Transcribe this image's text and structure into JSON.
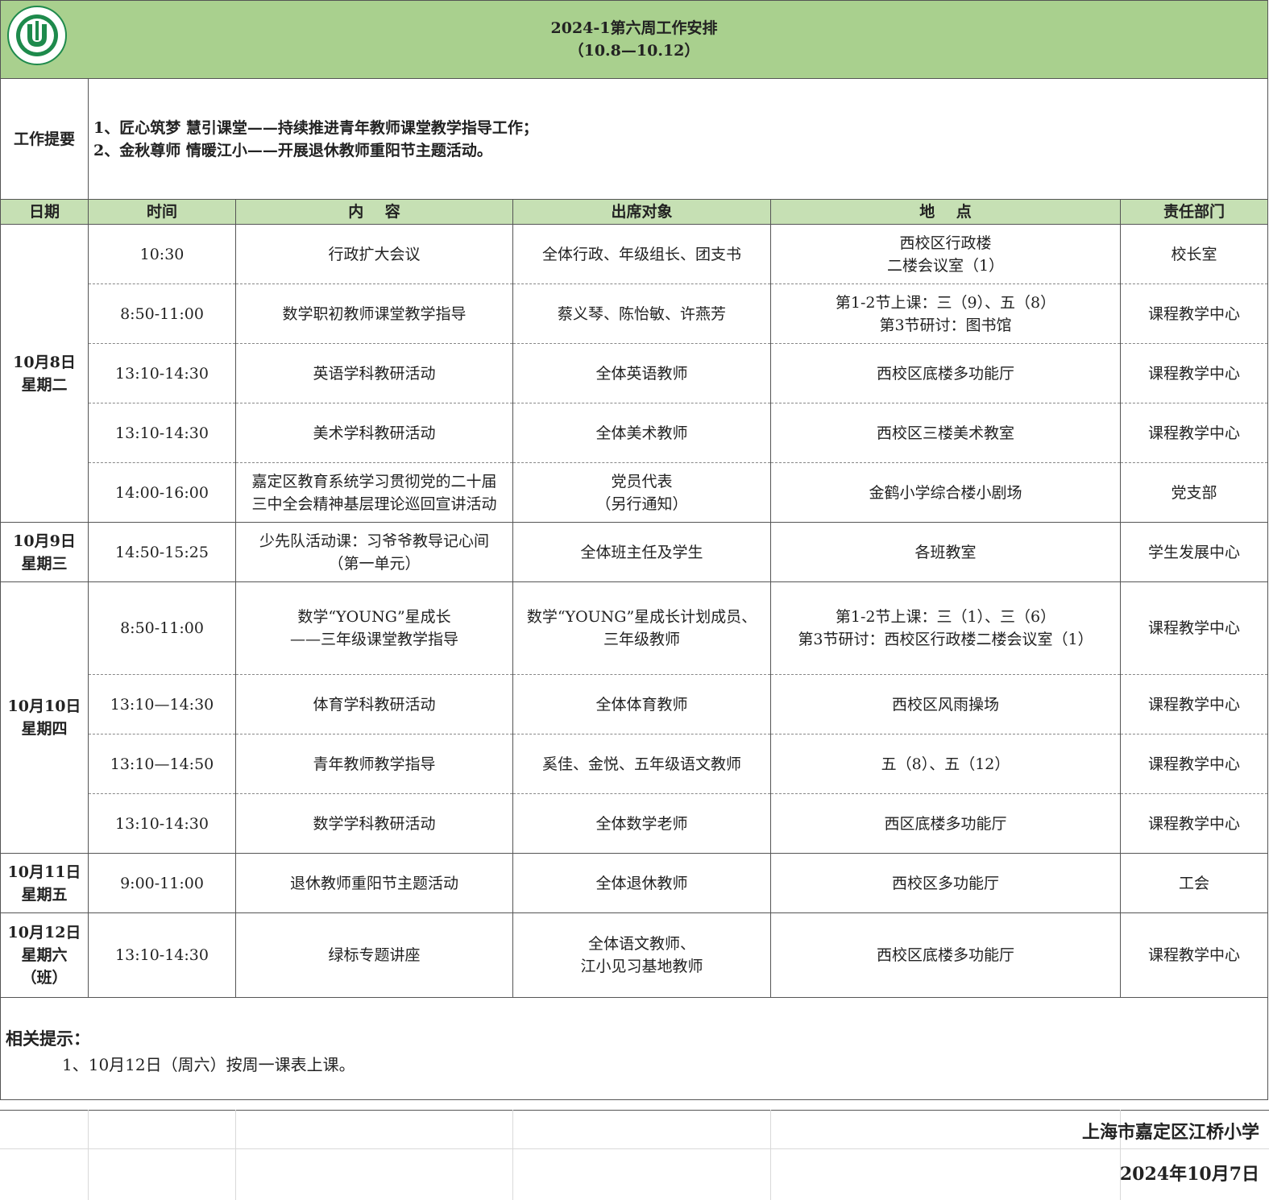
{
  "title": {
    "line1": "2024-1第六周工作安排",
    "line2": "（10.8—10.12）"
  },
  "logo": {
    "icon": "school-logo-icon",
    "color": "#1e8a4c"
  },
  "summary": {
    "label": "工作提要",
    "items": [
      "1、匠心筑梦  慧引课堂——持续推进青年教师课堂教学指导工作；",
      "2、金秋尊师  情暖江小——开展退休教师重阳节主题活动。"
    ]
  },
  "headers": {
    "date": "日期",
    "time": "时间",
    "content": "内    容",
    "attendees": "出席对象",
    "location": "地    点",
    "department": "责任部门"
  },
  "days": [
    {
      "date": "10月8日",
      "weekday": "星期二",
      "rows": [
        {
          "time": "10:30",
          "content": "行政扩大会议",
          "attendees": "全体行政、年级组长、团支书",
          "location": "西校区行政楼\n二楼会议室（1）",
          "department": "校长室"
        },
        {
          "time": "8:50-11:00",
          "content": "数学职初教师课堂教学指导",
          "attendees": "蔡义琴、陈怡敏、许燕芳",
          "location": "第1-2节上课：三（9）、五（8）\n第3节研讨：图书馆",
          "department": "课程教学中心"
        },
        {
          "time": "13:10-14:30",
          "content": "英语学科教研活动",
          "attendees": "全体英语教师",
          "location": "西校区底楼多功能厅",
          "department": "课程教学中心"
        },
        {
          "time": "13:10-14:30",
          "content": "美术学科教研活动",
          "attendees": "全体美术教师",
          "location": "西校区三楼美术教室",
          "department": "课程教学中心"
        },
        {
          "time": "14:00-16:00",
          "content": "嘉定区教育系统学习贯彻党的二十届\n三中全会精神基层理论巡回宣讲活动",
          "attendees": "党员代表\n（另行通知）",
          "location": "金鹤小学综合楼小剧场",
          "department": "党支部"
        }
      ]
    },
    {
      "date": "10月9日",
      "weekday": "星期三",
      "rows": [
        {
          "time": "14:50-15:25",
          "content": "少先队活动课：习爷爷教导记心间\n（第一单元）",
          "attendees": "全体班主任及学生",
          "location": "各班教室",
          "department": "学生发展中心"
        }
      ]
    },
    {
      "date": "10月10日",
      "weekday": "星期四",
      "rows": [
        {
          "time": "8:50-11:00",
          "content": "数学“YOUNG”星成长\n——三年级课堂教学指导",
          "attendees": "数学“YOUNG”星成长计划成员、\n三年级教师",
          "location": "第1-2节上课：三（1）、三（6）\n第3节研讨：西校区行政楼二楼会议室（1）",
          "department": "课程教学中心"
        },
        {
          "time": "13:10—14:30",
          "content": "体育学科教研活动",
          "attendees": "全体体育教师",
          "location": "西校区风雨操场",
          "department": "课程教学中心"
        },
        {
          "time": "13:10—14:50",
          "content": "青年教师教学指导",
          "attendees": "奚佳、金悦、五年级语文教师",
          "location": "五（8）、五（12）",
          "department": "课程教学中心"
        },
        {
          "time": "13:10-14:30",
          "content": "数学学科教研活动",
          "attendees": "全体数学老师",
          "location": "西区底楼多功能厅",
          "department": "课程教学中心"
        }
      ]
    },
    {
      "date": "10月11日",
      "weekday": "星期五",
      "rows": [
        {
          "time": "9:00-11:00",
          "content": "退休教师重阳节主题活动",
          "attendees": "全体退休教师",
          "location": "西校区多功能厅",
          "department": "工会"
        }
      ]
    },
    {
      "date": "10月12日",
      "weekday": "星期六",
      "note": "（班）",
      "rows": [
        {
          "time": "13:10-14:30",
          "content": "绿标专题讲座",
          "attendees": "全体语文教师、\n江小见习基地教师",
          "location": "西校区底楼多功能厅",
          "department": "课程教学中心"
        }
      ]
    }
  ],
  "tips": {
    "title": "相关提示：",
    "items": [
      "1、10月12日（周六）按周一课表上课。"
    ]
  },
  "signature": {
    "school": "上海市嘉定区江桥小学",
    "date": "2024年10月7日"
  }
}
